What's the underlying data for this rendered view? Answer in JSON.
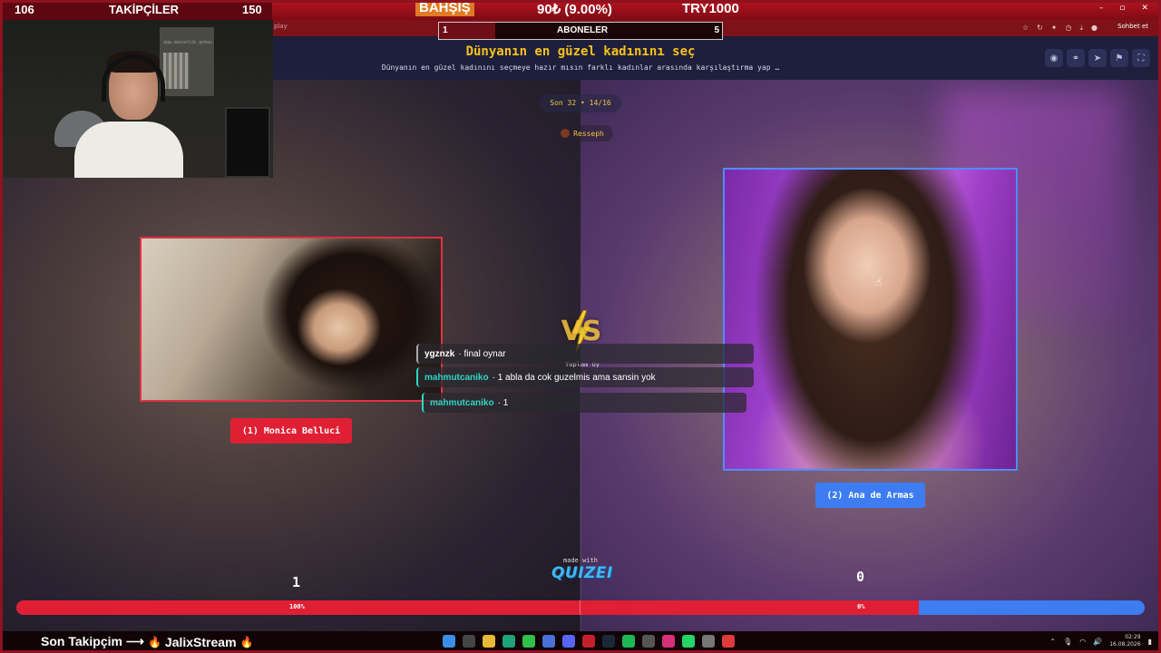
{
  "stream": {
    "followers_current": "106",
    "followers_label": "TAKİPÇİLER",
    "followers_goal": "150",
    "tip_label": "BAHŞİŞ",
    "tip_amount": "90₺ (9.00%)",
    "tip_goal": "TRY1000",
    "subs_current": "1",
    "subs_label": "ABONELER",
    "subs_goal": "5",
    "subs_progress": 0.2,
    "last_follower_label": "Son Takipçim ⟶",
    "last_follower_name": "JalixStream",
    "cam_watermark": "qqa.masonlxb gnkeu"
  },
  "browser": {
    "url_fragment": "play",
    "chat_button": "Sohbet et",
    "icons": [
      "star-icon",
      "refresh-icon",
      "extension-icon",
      "history-icon",
      "download-icon",
      "profile-icon"
    ]
  },
  "quiz": {
    "title": "Dünyanın en güzel kadınını seç",
    "subtitle": "Dünyanın en güzel kadınını seçmeye hazır mısın farklı kadınlar arasında karşılaştırma yap …",
    "round": "Son 32 • 14/16",
    "author": "Resseph",
    "header_icons": [
      "eye-icon",
      "link-icon",
      "share-icon",
      "flag-icon",
      "fullscreen-icon"
    ],
    "vs": "VS",
    "total_label": "Toplam Oy",
    "left": {
      "label": "(1) Monica Belluci",
      "score": "1",
      "percent_label": "100%"
    },
    "right": {
      "label": "(2) Ana de Armas",
      "score": "0",
      "percent_label": "0%"
    },
    "left_share": 0.8,
    "made_with": "made with",
    "brand": "QUIZEI"
  },
  "chat": [
    {
      "user": "ygznzk",
      "message": "final oynar"
    },
    {
      "user": "mahmutcaniko",
      "message": "1 abla da cok guzelmis ama sansin yok"
    },
    {
      "user": "mahmutcaniko",
      "message": "1"
    }
  ],
  "taskbar": {
    "time": "02:29",
    "date": "16.08.2026",
    "accent_red": "#e01f34",
    "accent_blue": "#3d7cf1"
  }
}
